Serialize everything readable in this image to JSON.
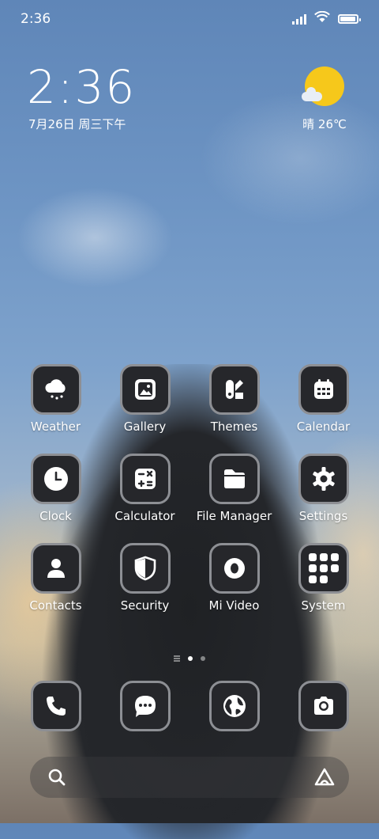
{
  "status_bar": {
    "time": "2:36",
    "battery_level": 0.95
  },
  "clock_widget": {
    "time": "2:36",
    "date": "7月26日 周三下午"
  },
  "weather_widget": {
    "condition": "晴",
    "temperature": "26℃"
  },
  "apps": [
    {
      "label": "Weather",
      "icon": "weather-cloud-rain-icon"
    },
    {
      "label": "Gallery",
      "icon": "gallery-image-icon"
    },
    {
      "label": "Themes",
      "icon": "themes-brush-icon"
    },
    {
      "label": "Calendar",
      "icon": "calendar-icon"
    },
    {
      "label": "Clock",
      "icon": "clock-icon"
    },
    {
      "label": "Calculator",
      "icon": "calculator-icon"
    },
    {
      "label": "File Manager",
      "icon": "folder-icon"
    },
    {
      "label": "Settings",
      "icon": "gear-icon"
    },
    {
      "label": "Contacts",
      "icon": "person-icon"
    },
    {
      "label": "Security",
      "icon": "shield-icon"
    },
    {
      "label": "Mi Video",
      "icon": "video-play-icon"
    },
    {
      "label": "System",
      "icon": "folder-grid-icon"
    }
  ],
  "page_indicator": {
    "pages": 2,
    "current": 1
  },
  "dock": [
    {
      "icon": "phone-icon"
    },
    {
      "icon": "messages-icon"
    },
    {
      "icon": "browser-globe-icon"
    },
    {
      "icon": "camera-icon"
    }
  ],
  "search_bar": {
    "left_icon": "search-icon",
    "right_icon": "assistant-icon"
  }
}
